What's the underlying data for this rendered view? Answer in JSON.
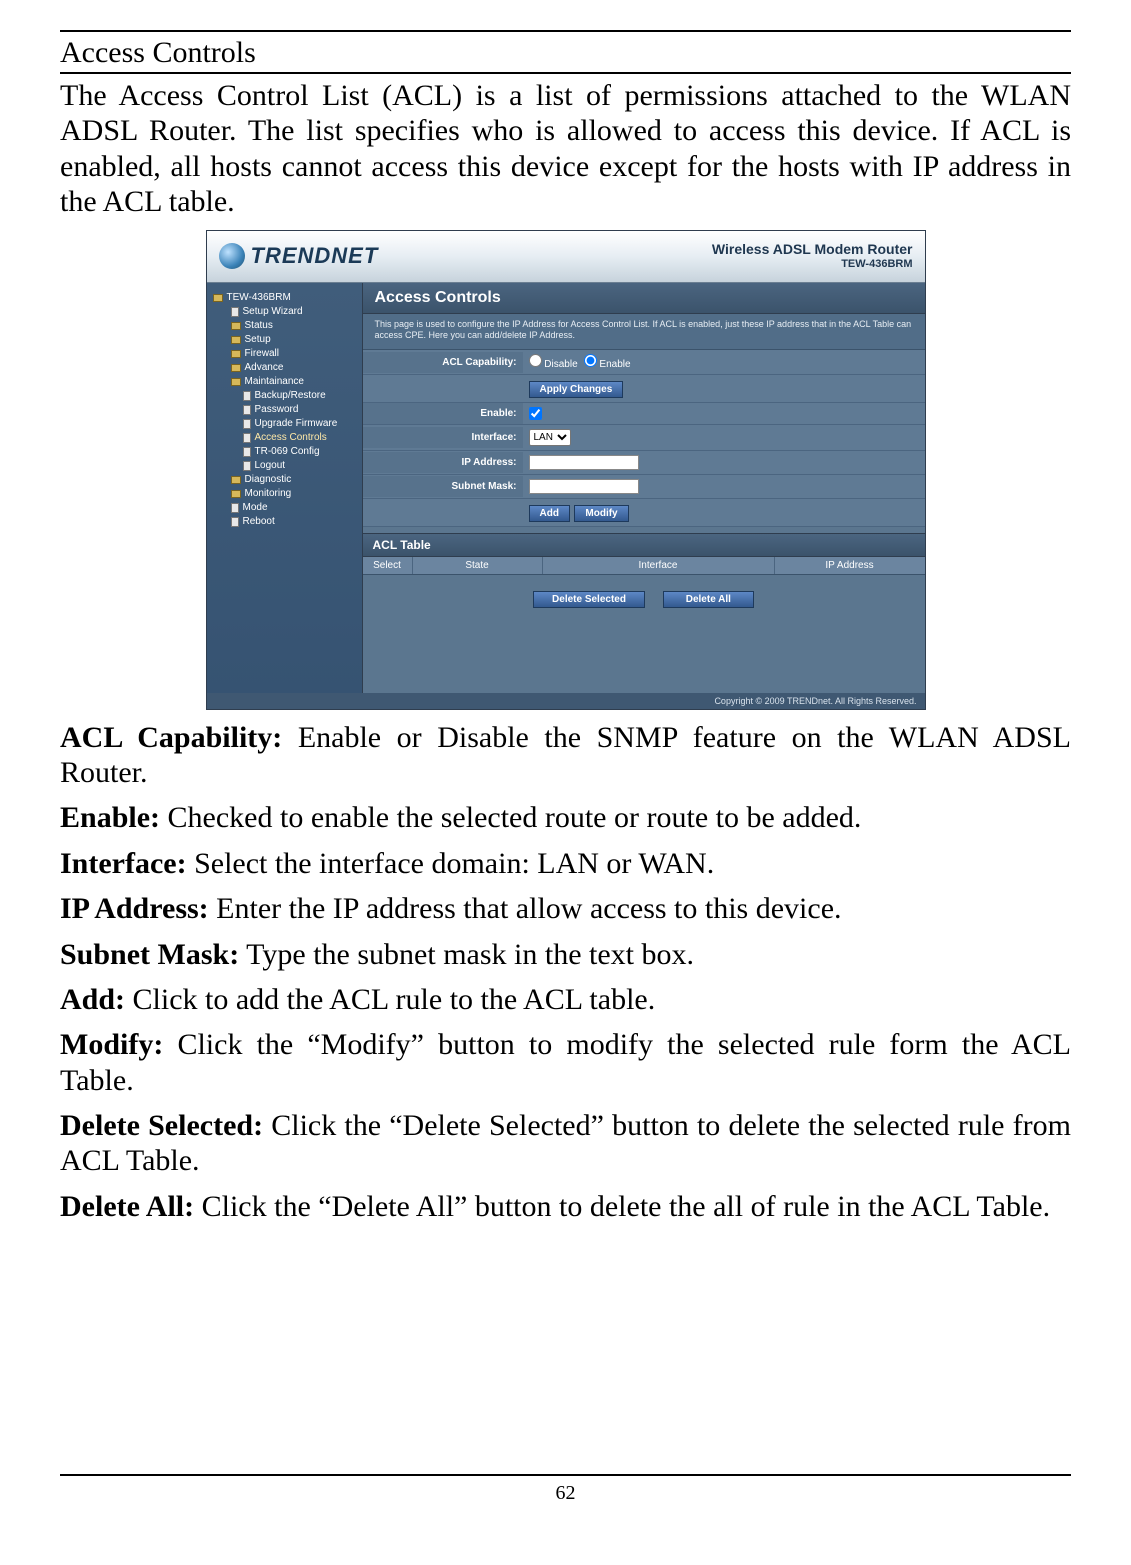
{
  "doc": {
    "title": "Access Controls",
    "intro": "The Access Control List (ACL) is a list of permissions attached to the WLAN ADSL Router. The list specifies who is allowed to access this device. If ACL is enabled, all hosts cannot access this device except for the hosts with IP address in the ACL table.",
    "page_number": "62"
  },
  "router": {
    "brand": "TRENDNET",
    "product_line1": "Wireless ADSL Modem Router",
    "product_line2": "TEW-436BRM",
    "root": "TEW-436BRM",
    "nav": {
      "setup_wizard": "Setup Wizard",
      "status": "Status",
      "setup": "Setup",
      "firewall": "Firewall",
      "advance": "Advance",
      "maintainance": "Maintainance",
      "backup": "Backup/Restore",
      "password": "Password",
      "upgrade": "Upgrade Firmware",
      "access_controls": "Access Controls",
      "tr069": "TR-069 Config",
      "logout": "Logout",
      "diagnostic": "Diagnostic",
      "monitoring": "Monitoring",
      "mode": "Mode",
      "reboot": "Reboot"
    },
    "panel": {
      "title": "Access Controls",
      "desc": "This page is used to configure the IP Address for Access Control List. If ACL is enabled, just these IP address that in the ACL Table can access CPE. Here you can add/delete IP Address.",
      "acl_cap_label": "ACL Capability:",
      "disable_label": "Disable",
      "enable_label": "Enable",
      "apply_btn": "Apply Changes",
      "enable_row": "Enable:",
      "interface_row": "Interface:",
      "interface_val": "LAN",
      "ip_row": "IP Address:",
      "subnet_row": "Subnet Mask:",
      "add_btn": "Add",
      "modify_btn": "Modify",
      "acl_table": "ACL Table",
      "col_select": "Select",
      "col_state": "State",
      "col_interface": "Interface",
      "col_ip": "IP Address",
      "del_sel_btn": "Delete Selected",
      "del_all_btn": "Delete All",
      "footer": "Copyright © 2009 TRENDnet. All Rights Reserved."
    }
  },
  "defs": {
    "acl_cap_b": "ACL Capability:",
    "acl_cap_t": " Enable or Disable the SNMP feature on the WLAN ADSL Router.",
    "enable_b": "Enable:",
    "enable_t": " Checked to enable the selected route or route to be added.",
    "interface_b": "Interface:",
    "interface_t": " Select the interface domain: LAN or WAN.",
    "ip_b": "IP Address:",
    "ip_t": " Enter the IP address that allow access to this device.",
    "subnet_b": "Subnet Mask:",
    "subnet_t": " Type the subnet mask in the text box.",
    "add_b": "Add:",
    "add_t": " Click to add the ACL rule to the ACL table.",
    "modify_b": "Modify:",
    "modify_t": " Click the “Modify” button to modify the selected rule form the ACL Table.",
    "delsel_b": "Delete Selected:",
    "delsel_t": " Click the “Delete Selected” button to delete the selected rule from ACL Table.",
    "delall_b": "Delete All:",
    "delall_t": " Click the “Delete All” button to delete the all of rule in the ACL Table."
  }
}
